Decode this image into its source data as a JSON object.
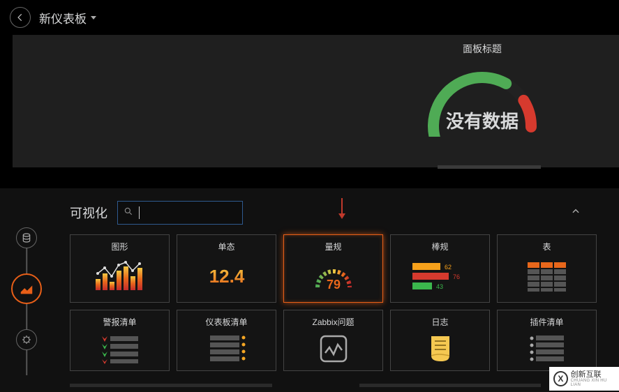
{
  "header": {
    "dashboard_title": "新仪表板"
  },
  "panel": {
    "title": "面板标题",
    "no_data_text": "没有数据"
  },
  "editor": {
    "section_title": "可视化"
  },
  "viz": {
    "graph": {
      "label": "图形"
    },
    "singlestat": {
      "label": "单态",
      "sample_value": "12.4"
    },
    "gauge": {
      "label": "量规",
      "sample_value": "79"
    },
    "bargauge": {
      "label": "棒规",
      "bars": [
        {
          "value": "62",
          "color": "#f7a11b"
        },
        {
          "value": "76",
          "color": "#d63a2e"
        },
        {
          "value": "43",
          "color": "#3bb74d"
        }
      ]
    },
    "table": {
      "label": "表"
    },
    "alertlist": {
      "label": "警报清单"
    },
    "dashlist": {
      "label": "仪表板清单"
    },
    "zabbix": {
      "label": "Zabbix问题"
    },
    "logs": {
      "label": "日志"
    },
    "pluginlist": {
      "label": "插件清单"
    }
  },
  "logo": {
    "mark": "X",
    "text": "创新互联",
    "sub": "CHUANG XIN HU LIAN"
  },
  "colors": {
    "accent": "#e85f18",
    "gauge_green": "#4fab55",
    "gauge_red": "#d63a2e"
  }
}
